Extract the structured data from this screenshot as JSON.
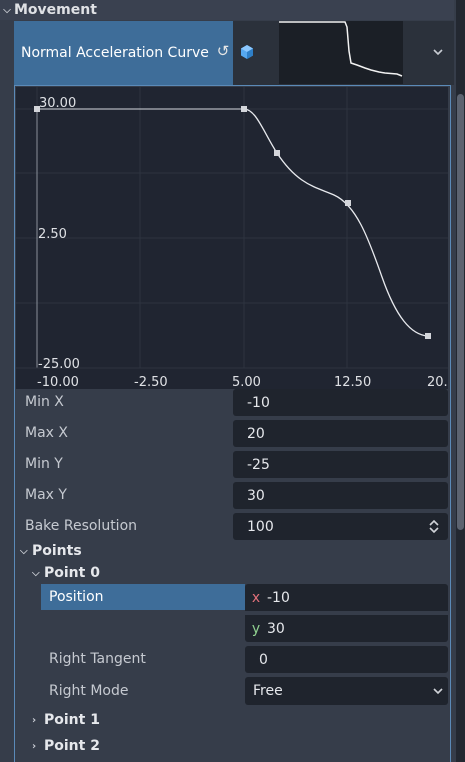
{
  "section": {
    "title": "Movement"
  },
  "property": {
    "label": "Normal Acceleration Curve"
  },
  "curve": {
    "y_labels": [
      "30.00",
      "2.50",
      "-25.00"
    ],
    "x_labels": [
      "-10.00",
      "-2.50",
      "5.00",
      "12.50",
      "20."
    ]
  },
  "fields": [
    {
      "label": "Min X",
      "value": "-10"
    },
    {
      "label": "Max X",
      "value": "20"
    },
    {
      "label": "Min Y",
      "value": "-25"
    },
    {
      "label": "Max Y",
      "value": "30"
    },
    {
      "label": "Bake Resolution",
      "value": "100"
    }
  ],
  "points": {
    "label": "Points",
    "point0": {
      "label": "Point 0",
      "position_label": "Position",
      "x_axis": "x",
      "y_axis": "y",
      "x_value": "-10",
      "y_value": "30",
      "right_tangent_label": "Right Tangent",
      "right_tangent_value": "0",
      "right_mode_label": "Right Mode",
      "right_mode_value": "Free"
    },
    "point1": {
      "label": "Point 1"
    },
    "point2": {
      "label": "Point 2"
    }
  },
  "colors": {
    "accent": "#3e6d99",
    "frame_border": "#5b8ab8",
    "axis_x": "#e0707a",
    "axis_y": "#8fd08f",
    "icon_cube": "#56a8f0"
  }
}
